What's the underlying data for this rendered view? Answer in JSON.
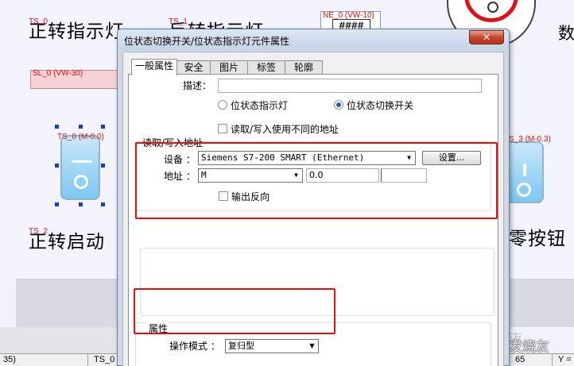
{
  "background": {
    "texts": {
      "forward_indicator": "正转指示灯",
      "reverse_indicator": "反转指示灯",
      "forward_start": "正转启动",
      "zero_button": "零按钮",
      "number_label": "数"
    },
    "tags": {
      "ts_top": "TS_0",
      "ts_top2": "TS_1",
      "slider": "SL_0 (VW-30)",
      "numeric": "NE_0 (VW-10)",
      "numeric_value": "####",
      "switch_left": "TS_0 (M-0.0)",
      "switch_right": "S_3 (M-0.3)",
      "ts_bottom": "TS_2"
    },
    "statusbar": {
      "a": "35)",
      "b": "TS_0",
      "c": "65",
      "d": "Y ="
    },
    "watermark": "头条 @PLC发烧友",
    "watermark_logo": "PLC发烧友"
  },
  "dialog": {
    "title": "位状态切换开关/位状态指示灯元件属性",
    "close_label": "✕",
    "tabs": [
      "一般属性",
      "安全",
      "图片",
      "标签",
      "轮廓"
    ],
    "description_label": "描述：",
    "description_value": "",
    "radio_indicator": "位状态指示灯",
    "radio_switch": "位状态切换开关",
    "radio_selected": "位状态切换开关",
    "diff_address_label": "读取/写入使用不同的地址",
    "rw_group_title": "读取/写入地址",
    "device_label": "设备 ：",
    "device_value": "Siemens S7-200 SMART (Ethernet)",
    "settings_button": "设置...",
    "address_label": "地址 ：",
    "address_type": "M",
    "address_value": "0.0",
    "invert_output_label": "输出反向",
    "props_group_title": "属性",
    "op_mode_label": "操作模式 ：",
    "op_mode_value": "复归型"
  },
  "colors": {
    "highlight": "#e01010",
    "tag_red": "#d01010",
    "switch_blue": "#7cc7f2"
  }
}
